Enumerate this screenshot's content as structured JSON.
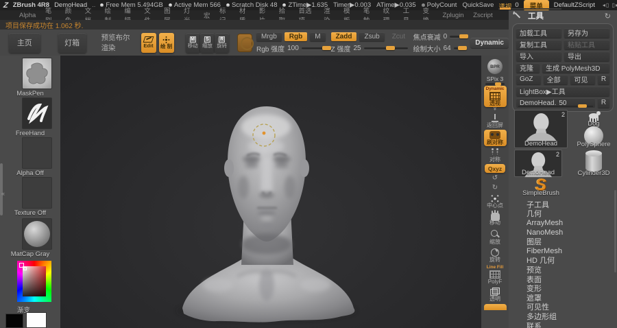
{
  "titlebar": {
    "app_name": "ZBrush 4R8",
    "document_name": "DemoHead",
    "dots": "..",
    "stats": [
      {
        "b": 1,
        "t": "Free Mem 5.494GB"
      },
      {
        "b": 1,
        "t": "Active Mem 566"
      },
      {
        "b": 1,
        "t": "Scratch Disk 48"
      },
      {
        "b": 1,
        "t": "ZTime▶1.635"
      },
      {
        "b": 0,
        "t": "Timer▶0.003"
      },
      {
        "b": 0,
        "t": "ATime▶0.035"
      },
      {
        "b": 1,
        "t": "PolyCount"
      },
      {
        "b": 0,
        "t": "QuickSave"
      }
    ],
    "persp_label": "透视",
    "persp_value": "0",
    "menu_button": "菜单",
    "zscript_name": "DefaultZScript"
  },
  "menubar": {
    "items": [
      "Alpha",
      "笔刷",
      "颜色",
      "文档",
      "绘制",
      "编辑",
      "文件",
      "图层",
      "灯光",
      "宏",
      "标记",
      "材质",
      "影片",
      "拾取",
      "首选项",
      "渲染",
      "模板",
      "笔触",
      "纹理",
      "工具",
      "变换",
      "Zplugin",
      "Zscript"
    ]
  },
  "status_message": "项目保存成功在 1.062 秒.",
  "toolbar": {
    "home": "主页",
    "lightbox": "灯箱",
    "preview_boolean": "预览布尔渲染",
    "edit": "Edit",
    "draw": "绘 制",
    "move": "移动",
    "move_icon": "M",
    "scale": "缩放",
    "scale_icon": "S",
    "rotate": "旋转",
    "rotate_icon": "R",
    "mrgb": "Mrgb",
    "rgb": "Rgb",
    "m": "M",
    "rgb_intensity_label": "Rgb 强度",
    "rgb_intensity_value": "100",
    "zadd": "Zadd",
    "zsub": "Zsub",
    "zcut": "Zcut",
    "z_intensity_label": "Z 强度",
    "z_intensity_value": "25",
    "focal_label": "焦点衰减",
    "focal_value": "0",
    "draw_size_label": "绘制大小",
    "draw_size_value": "64",
    "dynamic": "Dynamic"
  },
  "sidebar": {
    "items": [
      {
        "caption": "MaskPen",
        "kind": "maskpen",
        "icon": "brush-thumbnail"
      },
      {
        "caption": "FreeHand",
        "kind": "freehand",
        "icon": "stroke-thumbnail"
      },
      {
        "caption": "Alpha Off",
        "kind": "empty",
        "icon": "alpha-thumbnail"
      },
      {
        "caption": "Texture Off",
        "kind": "empty",
        "icon": "texture-thumbnail"
      },
      {
        "caption": "MatCap Gray",
        "kind": "matcap",
        "icon": "material-sphere"
      }
    ],
    "gradient_label": "渐变"
  },
  "shelf": {
    "items": [
      {
        "kind": "bpr",
        "caption": "BPR",
        "name": "bpr-render-button"
      },
      {
        "kind": "slider",
        "label": "SPix",
        "value": "3",
        "name": "spix-slider"
      },
      {
        "kind": "btn",
        "icon": "grid",
        "top": "Dynamic",
        "caption": "透视",
        "active": 1,
        "name": "perspective-button"
      },
      {
        "kind": "divider",
        "name": "shelf-divider"
      },
      {
        "kind": "btn",
        "icon": "frame",
        "caption": "返回屏",
        "active": 0,
        "name": "frame-button"
      },
      {
        "kind": "btn",
        "icon": "sym",
        "caption": "刷对称",
        "active": 1,
        "name": "symmetry-button"
      },
      {
        "kind": "btn",
        "icon": "pose",
        "caption": "对称",
        "active": 0,
        "name": "mirror-button"
      },
      {
        "kind": "qxyz",
        "caption": "Qxyz",
        "active": 1,
        "name": "qxyz-button"
      },
      {
        "kind": "mini",
        "glyph": "↺",
        "name": "orbit-left-button"
      },
      {
        "kind": "mini",
        "glyph": "↻",
        "name": "orbit-right-button"
      },
      {
        "kind": "btn",
        "icon": "dots",
        "caption": "中心点",
        "active": 0,
        "name": "center-point-button"
      },
      {
        "kind": "btn",
        "icon": "hand",
        "caption": "移动",
        "active": 0,
        "name": "pan-button"
      },
      {
        "kind": "btn",
        "icon": "magnify",
        "caption": "缩放",
        "active": 0,
        "name": "zoom-button"
      },
      {
        "kind": "btn",
        "icon": "rotate",
        "caption": "旋转",
        "active": 0,
        "name": "rotate-canvas-button"
      },
      {
        "kind": "btn",
        "icon": "grid2",
        "top": "Line Fill",
        "caption": "PolyF",
        "active": 0,
        "name": "polyframe-button"
      },
      {
        "kind": "btn",
        "icon": "layers",
        "caption": "透明",
        "active": 0,
        "name": "transparent-button"
      },
      {
        "kind": "partial",
        "name": "shelf-partial-button"
      }
    ]
  },
  "tool_panel": {
    "header": "工具",
    "rows": [
      [
        {
          "t": "加载工具"
        },
        {
          "t": "另存为"
        }
      ],
      [
        {
          "t": "复制工具"
        },
        {
          "t": "粘贴工具",
          "dis": 1
        }
      ],
      [
        {
          "t": "导入"
        },
        {
          "t": "导出"
        }
      ],
      [
        {
          "t": "克隆",
          "small": 1
        },
        {
          "t": "生成 PolyMesh3D"
        }
      ],
      [
        {
          "t": "GoZ"
        },
        {
          "t": "全部"
        },
        {
          "t": "可见"
        },
        {
          "t": "R",
          "sq": 1
        }
      ],
      [
        {
          "t": "LightBox▶工具"
        }
      ]
    ],
    "slider_label": "DemoHead.",
    "slider_value": "50",
    "slider_r": "R",
    "thumbnails": [
      {
        "caption": "DemoHead",
        "badge": "2",
        "kind": "head"
      },
      {
        "caption": "Dog",
        "kind": "dog"
      },
      {
        "caption": "PolySphere",
        "kind": "sphere"
      },
      {
        "caption": "DemoHead",
        "badge": "2",
        "kind": "head"
      },
      {
        "caption": "Cylinder3D",
        "kind": "cylinder"
      },
      {
        "caption": "SimpleBrush",
        "kind": "sbrush"
      }
    ],
    "subpalettes": [
      "子工具",
      "几何",
      "ArrayMesh",
      "NanoMesh",
      "图层",
      "FiberMesh",
      "HD 几何",
      "预览",
      "表面",
      "变形",
      "遮罩",
      "可见性",
      "多边形组",
      "联系"
    ]
  },
  "colors": {
    "accent": "#e39b3d",
    "status_text": "#c9872f",
    "canvas_bg": "#2b2b2d"
  }
}
